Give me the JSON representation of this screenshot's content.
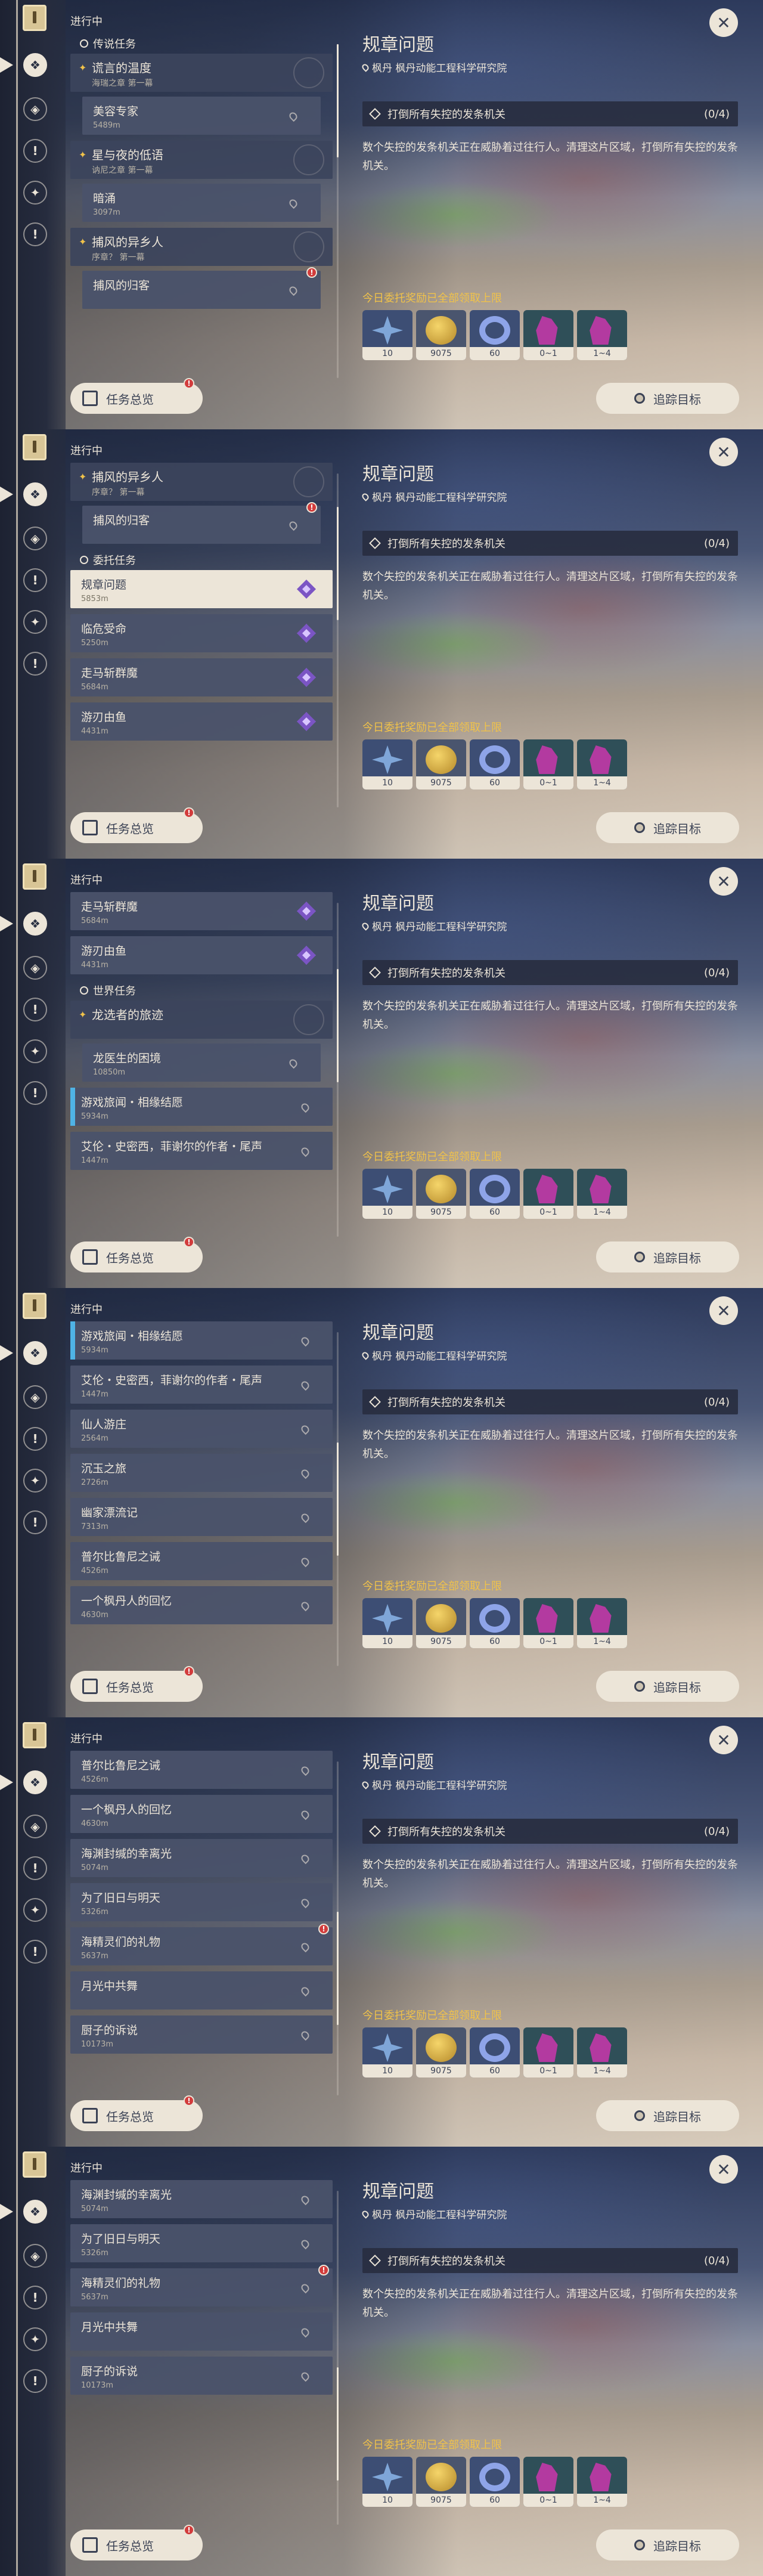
{
  "app": {
    "list_header": "进行中",
    "overview_button": "任务总览",
    "track_button": "追踪目标",
    "overview_badge": "!",
    "close_glyph": "✕"
  },
  "rail_icons": [
    "book-icon",
    "quest-all-icon",
    "archon-quest-icon",
    "legend-quest-icon",
    "commission-quest-icon",
    "world-quest-icon"
  ],
  "detail": {
    "title": "规章问题",
    "location": "枫丹 枫丹动能工程科学研究院",
    "objective": "打倒所有失控的发条机关",
    "objective_count": "(0/4)",
    "description": "数个失控的发条机关正在威胁着过往行人。清理这片区域，打倒所有失控的发条机关。",
    "rewards_hint": "今日委托奖励已全部领取上限",
    "rewards": [
      {
        "icon": "adventure-exp-icon",
        "label": "10"
      },
      {
        "icon": "mora-icon",
        "label": "9075"
      },
      {
        "icon": "companionship-exp-icon",
        "label": "60"
      },
      {
        "icon": "primogem-icon",
        "label": "0~1"
      },
      {
        "icon": "crystal-icon",
        "label": "1~4"
      }
    ],
    "colors": {
      "accent": "#f0c24a",
      "panel": "#ece5d8",
      "alert": "#d23c3c"
    }
  },
  "panels": [
    {
      "items": [
        {
          "kind": "cat",
          "label": "传说任务"
        },
        {
          "kind": "chapter",
          "title": "谎言的温度",
          "subtitle": "海瑞之章 第一幕"
        },
        {
          "kind": "quest",
          "title": "美容专家",
          "distance": "5489m",
          "marker": "loc"
        },
        {
          "kind": "chapter",
          "title": "星与夜的低语",
          "subtitle": "讷尼之章 第一幕"
        },
        {
          "kind": "quest",
          "title": "暗涌",
          "distance": "3097m",
          "marker": "loc"
        },
        {
          "kind": "chapter",
          "title": "捕风的异乡人",
          "subtitle": "序章？ 第一幕"
        },
        {
          "kind": "quest",
          "title": "捕风的归客",
          "distance": "",
          "marker": "loc",
          "badge": true
        }
      ],
      "scroll": 0.0
    },
    {
      "items": [
        {
          "kind": "chapter",
          "title": "捕风的异乡人",
          "subtitle": "序章？ 第一幕"
        },
        {
          "kind": "quest",
          "title": "捕风的归客",
          "distance": "",
          "marker": "loc",
          "badge": true
        },
        {
          "kind": "cat",
          "label": "委托任务"
        },
        {
          "kind": "quest",
          "title": "规章问题",
          "distance": "5853m",
          "marker": "gem",
          "selected": true,
          "world": true
        },
        {
          "kind": "quest",
          "title": "临危受命",
          "distance": "5250m",
          "marker": "gem",
          "world": true
        },
        {
          "kind": "quest",
          "title": "走马斩群魔",
          "distance": "5684m",
          "marker": "gem",
          "world": true
        },
        {
          "kind": "quest",
          "title": "游刃由鱼",
          "distance": "4431m",
          "marker": "gem",
          "world": true
        }
      ],
      "scroll": 0.15
    },
    {
      "items": [
        {
          "kind": "quest",
          "title": "走马斩群魔",
          "distance": "5684m",
          "marker": "gem",
          "world": true
        },
        {
          "kind": "quest",
          "title": "游刃由鱼",
          "distance": "4431m",
          "marker": "gem",
          "world": true
        },
        {
          "kind": "cat",
          "label": "世界任务"
        },
        {
          "kind": "chapter",
          "title": "龙选者的旅迹",
          "subtitle": ""
        },
        {
          "kind": "quest",
          "title": "龙医生的困境",
          "distance": "10850m",
          "marker": "loc"
        },
        {
          "kind": "quest",
          "title": "游戏旅闻・相缘结愿",
          "distance": "5934m",
          "marker": "loc",
          "world": true,
          "bar": true
        },
        {
          "kind": "quest",
          "title": "艾伦・史密西，菲谢尔的作者・尾声",
          "distance": "1447m",
          "marker": "loc",
          "world": true
        }
      ],
      "scroll": 0.3
    },
    {
      "items": [
        {
          "kind": "quest",
          "title": "游戏旅闻・相缘结愿",
          "distance": "5934m",
          "marker": "loc",
          "world": true,
          "bar": true
        },
        {
          "kind": "quest",
          "title": "艾伦・史密西，菲谢尔的作者・尾声",
          "distance": "1447m",
          "marker": "loc",
          "world": true
        },
        {
          "kind": "quest",
          "title": "仙人游庄",
          "distance": "2564m",
          "marker": "loc",
          "world": true
        },
        {
          "kind": "quest",
          "title": "沉玉之旅",
          "distance": "2726m",
          "marker": "loc",
          "world": true
        },
        {
          "kind": "quest",
          "title": "幽家漂流记",
          "distance": "7313m",
          "marker": "loc",
          "world": true
        },
        {
          "kind": "quest",
          "title": "普尔比鲁尼之诫",
          "distance": "4526m",
          "marker": "loc",
          "world": true
        },
        {
          "kind": "quest",
          "title": "一个枫丹人的回忆",
          "distance": "4630m",
          "marker": "loc",
          "world": true
        }
      ],
      "scroll": 0.5
    },
    {
      "items": [
        {
          "kind": "quest",
          "title": "普尔比鲁尼之诫",
          "distance": "4526m",
          "marker": "loc",
          "world": true
        },
        {
          "kind": "quest",
          "title": "一个枫丹人的回忆",
          "distance": "4630m",
          "marker": "loc",
          "world": true
        },
        {
          "kind": "quest",
          "title": "海渊封缄的幸离光",
          "distance": "5074m",
          "marker": "loc",
          "world": true
        },
        {
          "kind": "quest",
          "title": "为了旧日与明天",
          "distance": "5326m",
          "marker": "loc",
          "world": true
        },
        {
          "kind": "quest",
          "title": "海精灵们的礼物",
          "distance": "5637m",
          "marker": "loc",
          "world": true,
          "badge": true
        },
        {
          "kind": "quest",
          "title": "月光中共舞",
          "distance": "",
          "marker": "loc",
          "world": true
        },
        {
          "kind": "quest",
          "title": "厨子的诉说",
          "distance": "10173m",
          "marker": "loc",
          "world": true
        }
      ],
      "scroll": 0.68
    },
    {
      "items": [
        {
          "kind": "quest",
          "title": "海渊封缄的幸离光",
          "distance": "5074m",
          "marker": "loc",
          "world": true
        },
        {
          "kind": "quest",
          "title": "为了旧日与明天",
          "distance": "5326m",
          "marker": "loc",
          "world": true
        },
        {
          "kind": "quest",
          "title": "海精灵们的礼物",
          "distance": "5637m",
          "marker": "loc",
          "world": true,
          "badge": true
        },
        {
          "kind": "quest",
          "title": "月光中共舞",
          "distance": "",
          "marker": "loc",
          "world": true
        },
        {
          "kind": "quest",
          "title": "厨子的诉说",
          "distance": "10173m",
          "marker": "loc",
          "world": true
        }
      ],
      "scroll": 0.8
    }
  ]
}
